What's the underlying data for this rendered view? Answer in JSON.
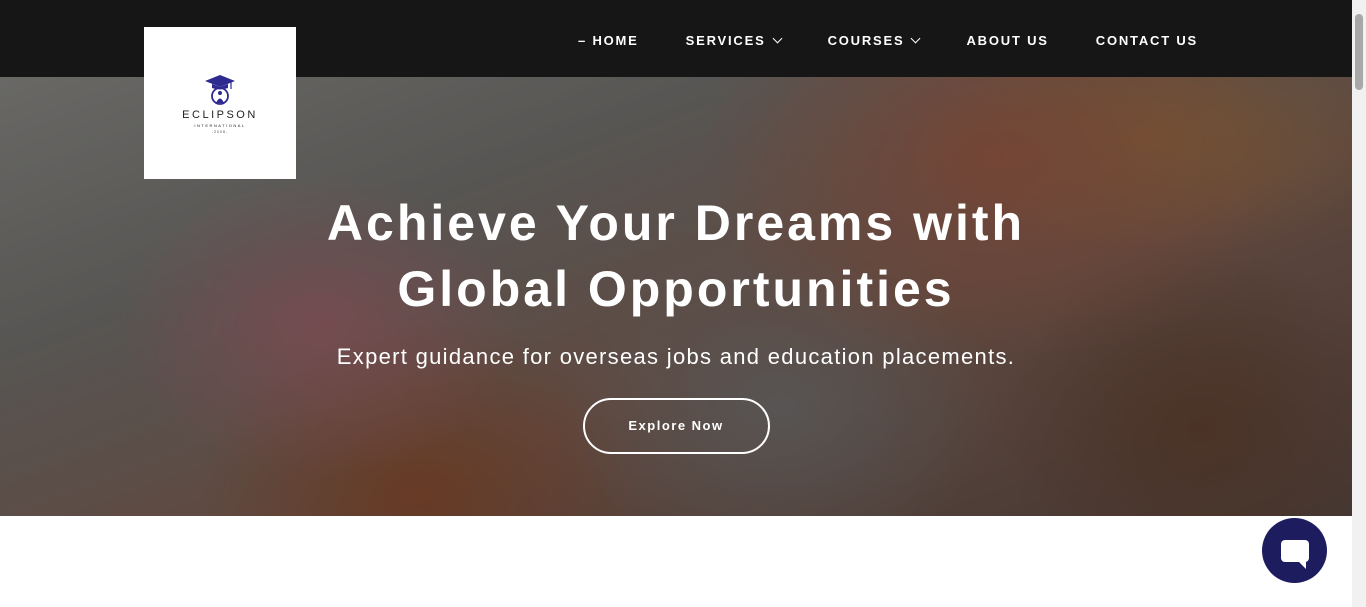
{
  "logo": {
    "name": "ECLIPSON",
    "sub": "INTERNATIONAL",
    "year": "-2008-",
    "color": "#2e2a8f"
  },
  "nav": [
    {
      "label": "– HOME"
    },
    {
      "label": "SERVICES",
      "dropdown": true
    },
    {
      "label": "COURSES",
      "dropdown": true
    },
    {
      "label": "ABOUT US"
    },
    {
      "label": "CONTACT US"
    }
  ],
  "hero": {
    "title_line1": "Achieve Your Dreams with",
    "title_line2": "Global Opportunities",
    "subtitle": "Expert guidance for overseas jobs and education placements.",
    "cta": "Explore Now"
  },
  "chat": {
    "icon": "chat-bubble-icon",
    "color": "#1d1c5e"
  }
}
